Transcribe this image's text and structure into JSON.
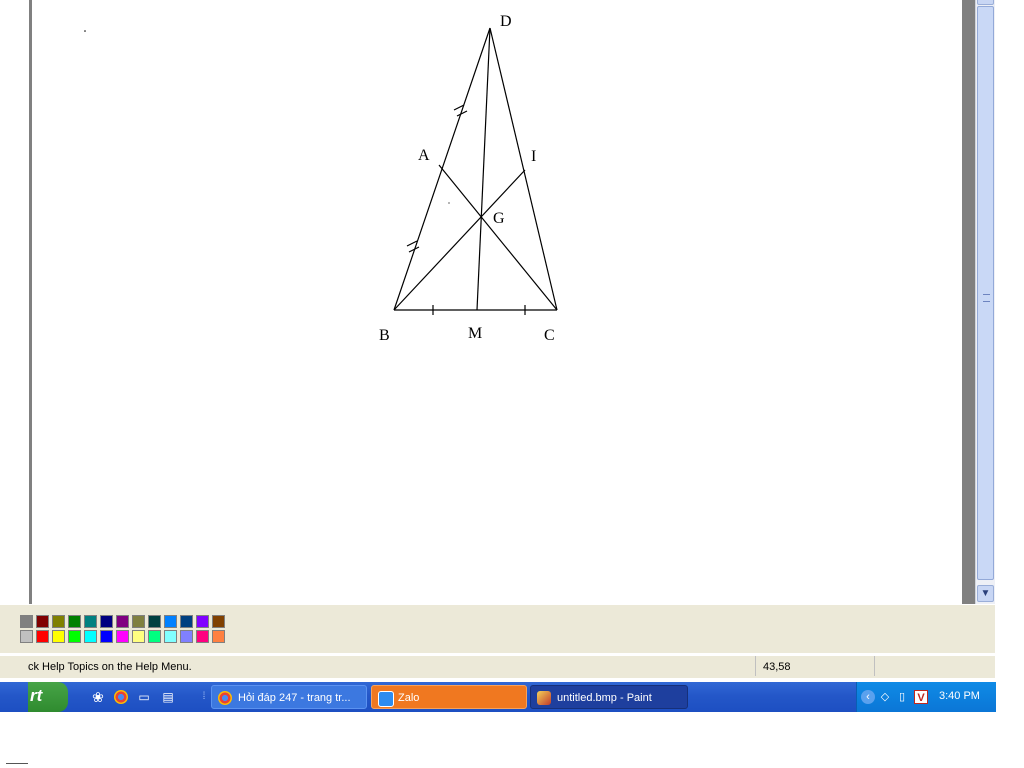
{
  "figure": {
    "labels": {
      "D": "D",
      "A": "A",
      "I": "I",
      "G": "G",
      "B": "B",
      "M": "M",
      "C": "C"
    }
  },
  "palette": {
    "row1": [
      "#808080",
      "#800000",
      "#808000",
      "#008000",
      "#008080",
      "#000080",
      "#800080",
      "#808040",
      "#004040",
      "#0080ff",
      "#004080",
      "#8000ff",
      "#804000"
    ],
    "row2": [
      "#c0c0c0",
      "#ff0000",
      "#ffff00",
      "#00ff00",
      "#00ffff",
      "#0000ff",
      "#ff00ff",
      "#ffff80",
      "#00ff80",
      "#80ffff",
      "#8080ff",
      "#ff0080",
      "#ff8040"
    ]
  },
  "status": {
    "help_text": "ck Help Topics on the Help Menu.",
    "coords": "43,58"
  },
  "taskbar": {
    "start_label": "rt",
    "tasks": [
      {
        "label": "Hỏi đáp 247 - trang tr...",
        "icon": "chrome-icon"
      },
      {
        "label": "Zalo",
        "icon": "zalo-icon"
      },
      {
        "label": "untitled.bmp - Paint",
        "icon": "paint-icon"
      }
    ],
    "clock": "3:40 PM"
  },
  "colors": {
    "taskbar_blue": "#2457c8",
    "zalo_task": "#f07820",
    "paint_task_active": "#1e3f9e"
  }
}
